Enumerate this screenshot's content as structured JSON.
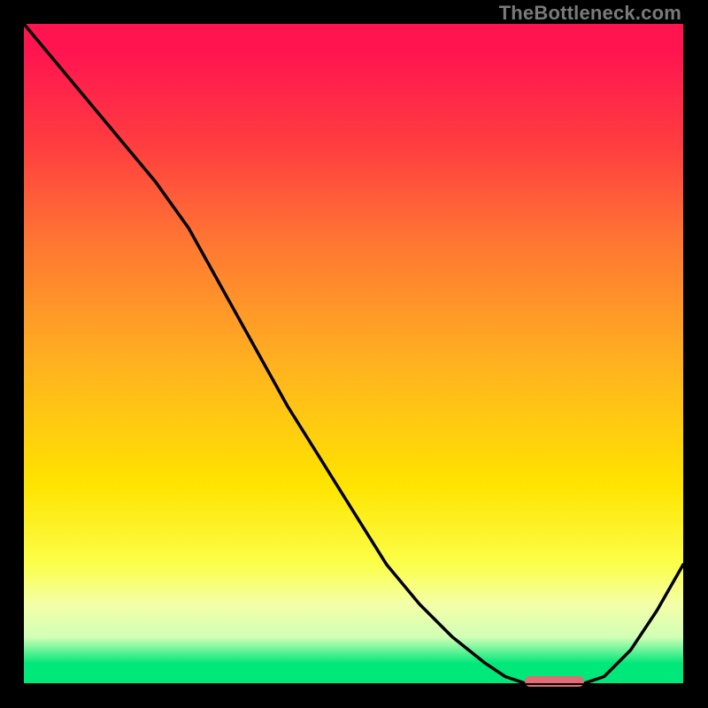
{
  "watermark": "TheBottleneck.com",
  "colors": {
    "gradient_top": "#ff1450",
    "gradient_mid1": "#ff7633",
    "gradient_mid2": "#ffe400",
    "gradient_bottom": "#00e87a",
    "curve": "#000000",
    "marker": "#e06c75",
    "background": "#000000"
  },
  "chart_data": {
    "type": "line",
    "title": "",
    "xlabel": "",
    "ylabel": "",
    "xlim": [
      0,
      100
    ],
    "ylim": [
      0,
      100
    ],
    "x": [
      0,
      5,
      10,
      15,
      20,
      25,
      30,
      35,
      40,
      45,
      50,
      55,
      60,
      65,
      70,
      73,
      76,
      79,
      82,
      85,
      88,
      92,
      96,
      100
    ],
    "values": [
      100,
      94,
      88,
      82,
      76,
      69,
      60,
      51,
      42,
      34,
      26,
      18,
      12,
      7,
      3,
      1,
      0,
      0,
      0,
      0,
      1,
      5,
      11,
      18
    ],
    "marker_range_x": [
      76,
      85
    ],
    "marker_y": 0
  }
}
